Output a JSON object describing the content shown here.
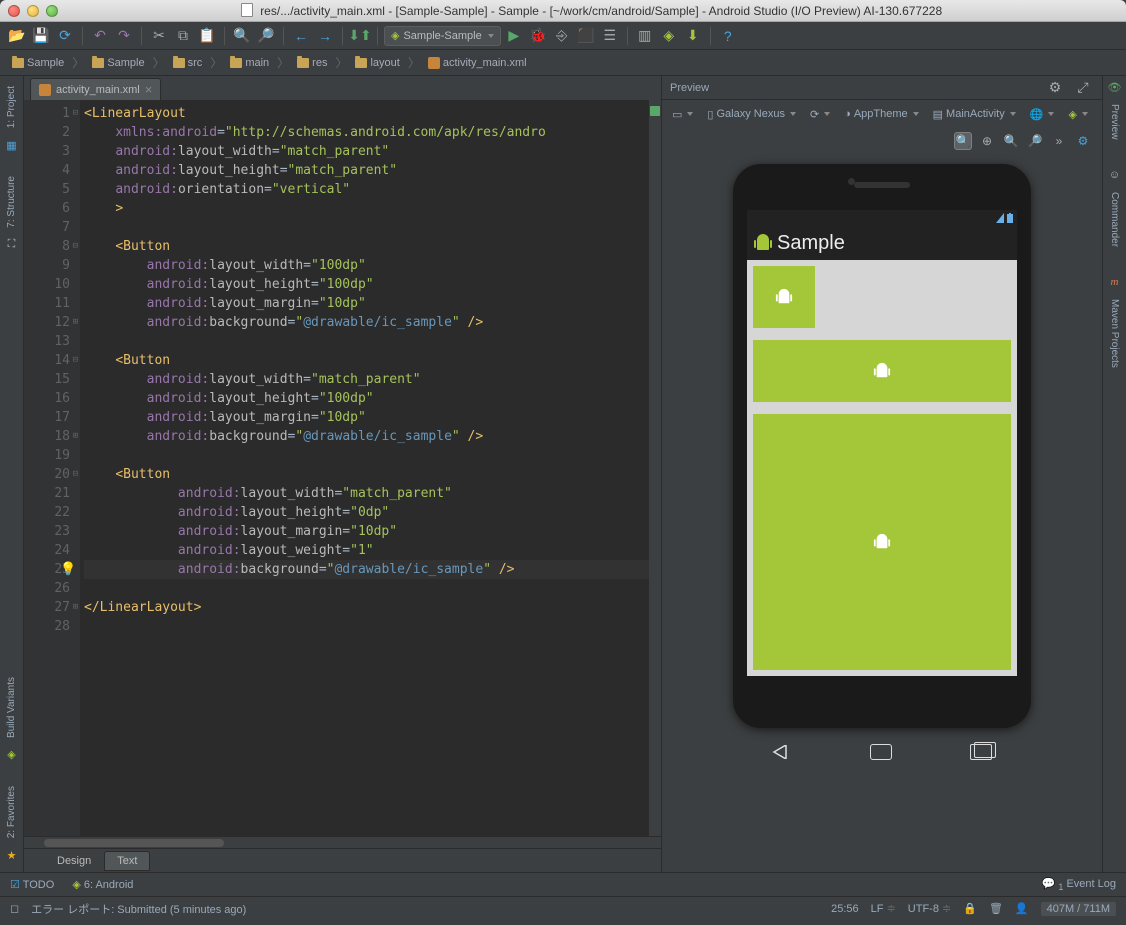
{
  "window": {
    "title": "res/.../activity_main.xml - [Sample-Sample] - Sample - [~/work/cm/android/Sample] - Android Studio (I/O Preview) AI-130.677228"
  },
  "toolbar": {
    "run_config": "Sample-Sample"
  },
  "breadcrumbs": [
    "Sample",
    "Sample",
    "src",
    "main",
    "res",
    "layout",
    "activity_main.xml"
  ],
  "side_left": {
    "project": "1: Project",
    "structure": "7: Structure",
    "variants": "Build Variants",
    "favorites": "2: Favorites"
  },
  "side_right": {
    "preview": "Preview",
    "commander": "Commander",
    "maven": "Maven Projects"
  },
  "editor": {
    "tab_name": "activity_main.xml",
    "line_numbers": [
      "1",
      "2",
      "3",
      "4",
      "5",
      "6",
      "7",
      "8",
      "9",
      "10",
      "11",
      "12",
      "13",
      "14",
      "15",
      "16",
      "17",
      "18",
      "19",
      "20",
      "21",
      "22",
      "23",
      "24",
      "25",
      "26",
      "27",
      "28"
    ],
    "code_lines": [
      {
        "i": "",
        "t": [
          [
            "tag",
            "<LinearLayout"
          ]
        ]
      },
      {
        "i": "    ",
        "t": [
          [
            "ns",
            "xmlns:android"
          ],
          [
            "plain",
            "="
          ],
          [
            "str",
            "\"http://schemas.android.com/apk/res/andro"
          ]
        ]
      },
      {
        "i": "    ",
        "t": [
          [
            "ns",
            "android:"
          ],
          [
            "attr",
            "layout_width"
          ],
          [
            "plain",
            "="
          ],
          [
            "str",
            "\"match_parent\""
          ]
        ]
      },
      {
        "i": "    ",
        "t": [
          [
            "ns",
            "android:"
          ],
          [
            "attr",
            "layout_height"
          ],
          [
            "plain",
            "="
          ],
          [
            "str",
            "\"match_parent\""
          ]
        ]
      },
      {
        "i": "    ",
        "t": [
          [
            "ns",
            "android:"
          ],
          [
            "attr",
            "orientation"
          ],
          [
            "plain",
            "="
          ],
          [
            "str",
            "\"vertical\""
          ]
        ]
      },
      {
        "i": "    ",
        "t": [
          [
            "tag",
            ">"
          ]
        ]
      },
      {
        "i": "",
        "t": []
      },
      {
        "i": "    ",
        "t": [
          [
            "tag",
            "<Button"
          ]
        ]
      },
      {
        "i": "        ",
        "t": [
          [
            "ns",
            "android:"
          ],
          [
            "attr",
            "layout_width"
          ],
          [
            "plain",
            "="
          ],
          [
            "str",
            "\"100dp\""
          ]
        ]
      },
      {
        "i": "        ",
        "t": [
          [
            "ns",
            "android:"
          ],
          [
            "attr",
            "layout_height"
          ],
          [
            "plain",
            "="
          ],
          [
            "str",
            "\"100dp\""
          ]
        ]
      },
      {
        "i": "        ",
        "t": [
          [
            "ns",
            "android:"
          ],
          [
            "attr",
            "layout_margin"
          ],
          [
            "plain",
            "="
          ],
          [
            "str",
            "\"10dp\""
          ]
        ]
      },
      {
        "i": "        ",
        "t": [
          [
            "ns",
            "android:"
          ],
          [
            "attr",
            "background"
          ],
          [
            "plain",
            "="
          ],
          [
            "str",
            "\""
          ],
          [
            "drw",
            "@drawable/ic_sample"
          ],
          [
            "str",
            "\""
          ],
          [
            "tag",
            " />"
          ]
        ]
      },
      {
        "i": "",
        "t": []
      },
      {
        "i": "    ",
        "t": [
          [
            "tag",
            "<Button"
          ]
        ]
      },
      {
        "i": "        ",
        "t": [
          [
            "ns",
            "android:"
          ],
          [
            "attr",
            "layout_width"
          ],
          [
            "plain",
            "="
          ],
          [
            "str",
            "\"match_parent\""
          ]
        ]
      },
      {
        "i": "        ",
        "t": [
          [
            "ns",
            "android:"
          ],
          [
            "attr",
            "layout_height"
          ],
          [
            "plain",
            "="
          ],
          [
            "str",
            "\"100dp\""
          ]
        ]
      },
      {
        "i": "        ",
        "t": [
          [
            "ns",
            "android:"
          ],
          [
            "attr",
            "layout_margin"
          ],
          [
            "plain",
            "="
          ],
          [
            "str",
            "\"10dp\""
          ]
        ]
      },
      {
        "i": "        ",
        "t": [
          [
            "ns",
            "android:"
          ],
          [
            "attr",
            "background"
          ],
          [
            "plain",
            "="
          ],
          [
            "str",
            "\""
          ],
          [
            "drw",
            "@drawable/ic_sample"
          ],
          [
            "str",
            "\""
          ],
          [
            "tag",
            " />"
          ]
        ]
      },
      {
        "i": "",
        "t": []
      },
      {
        "i": "    ",
        "t": [
          [
            "tag",
            "<Button"
          ]
        ]
      },
      {
        "i": "            ",
        "t": [
          [
            "ns",
            "android:"
          ],
          [
            "attr",
            "layout_width"
          ],
          [
            "plain",
            "="
          ],
          [
            "str",
            "\"match_parent\""
          ]
        ]
      },
      {
        "i": "            ",
        "t": [
          [
            "ns",
            "android:"
          ],
          [
            "attr",
            "layout_height"
          ],
          [
            "plain",
            "="
          ],
          [
            "str",
            "\"0dp\""
          ]
        ]
      },
      {
        "i": "            ",
        "t": [
          [
            "ns",
            "android:"
          ],
          [
            "attr",
            "layout_margin"
          ],
          [
            "plain",
            "="
          ],
          [
            "str",
            "\"10dp\""
          ]
        ]
      },
      {
        "i": "            ",
        "t": [
          [
            "ns",
            "android:"
          ],
          [
            "attr",
            "layout_weight"
          ],
          [
            "plain",
            "="
          ],
          [
            "str",
            "\"1\""
          ]
        ]
      },
      {
        "i": "            ",
        "t": [
          [
            "ns",
            "android:"
          ],
          [
            "attr",
            "background"
          ],
          [
            "plain",
            "="
          ],
          [
            "str",
            "\""
          ],
          [
            "drw",
            "@drawable/ic_sample"
          ],
          [
            "str",
            "\""
          ],
          [
            "tag",
            " />"
          ]
        ],
        "hl": true
      },
      {
        "i": "",
        "t": []
      },
      {
        "i": "",
        "t": [
          [
            "tag",
            "</LinearLayout>"
          ]
        ]
      },
      {
        "i": "",
        "t": []
      }
    ],
    "design_tab": "Design",
    "text_tab": "Text"
  },
  "preview": {
    "title": "Preview",
    "device": "Galaxy Nexus",
    "theme": "AppTheme",
    "activity": "MainActivity",
    "app_title": "Sample"
  },
  "bottom": {
    "todo": "TODO",
    "android": "6: Android",
    "eventlog": "Event Log"
  },
  "status": {
    "msg": "エラー レポート: Submitted (5 minutes ago)",
    "pos": "25:56",
    "lf": "LF",
    "enc": "UTF-8",
    "mem": "407M / 711M",
    "event_count": "1"
  }
}
